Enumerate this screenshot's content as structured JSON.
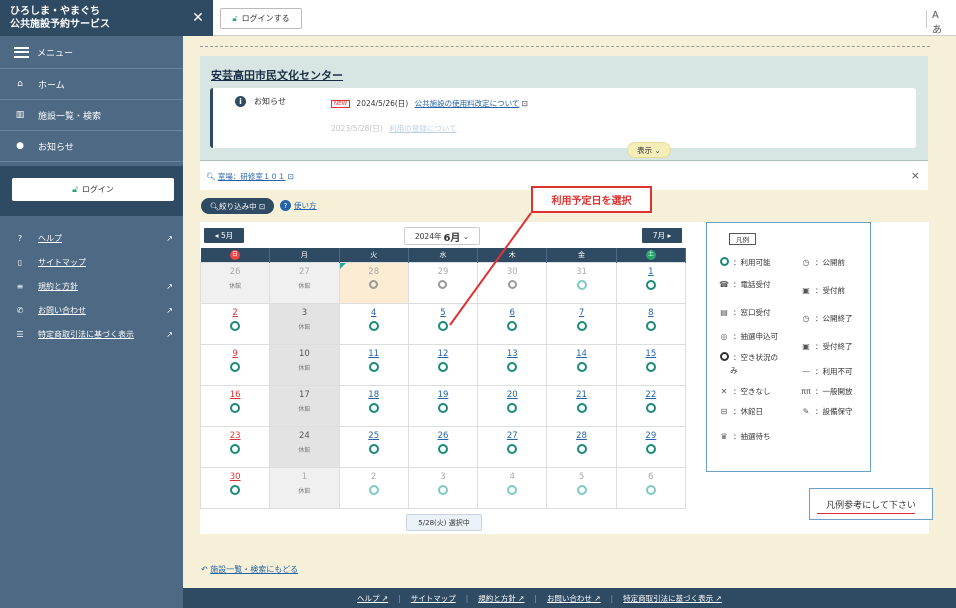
{
  "brand": {
    "line1": "ひろしま・やまぐち",
    "line2": "公共施設予約サービス"
  },
  "sidebar": {
    "menu_label": "メニュー",
    "items": [
      {
        "icon": "⌂",
        "label": "ホーム"
      },
      {
        "icon": "▥",
        "label": "施設一覧・検索"
      },
      {
        "icon": "●",
        "label": "お知らせ"
      }
    ],
    "login_label": "ログイン",
    "links": [
      {
        "icon": "?",
        "label": "ヘルプ",
        "ext": "↗"
      },
      {
        "icon": "▯",
        "label": "サイトマップ",
        "ext": ""
      },
      {
        "icon": "≡",
        "label": "規約と方針",
        "ext": "↗"
      },
      {
        "icon": "✆",
        "label": "お問い合わせ",
        "ext": "↗"
      },
      {
        "icon": "☰",
        "label": "特定商取引法に基づく表示",
        "ext": "↗"
      }
    ]
  },
  "topbar": {
    "close_icon": "✕",
    "login_label": "ログインする",
    "font_label": "Aあ"
  },
  "facility": {
    "name": "安芸高田市民文化センター"
  },
  "notice": {
    "label": "お知らせ",
    "row1": {
      "badge": "NEW",
      "date": "2024/5/26(日)",
      "text": "公共施設の使用料改定について"
    },
    "row2": {
      "date": "2023/5/28(日)",
      "text": "利用の登録について"
    },
    "show_label": "表示"
  },
  "filter": {
    "text": "室場：研修室１０１",
    "close": "×",
    "button": "絞り込み中",
    "howto": "使い方"
  },
  "calendar": {
    "prev": "5月",
    "next": "7月",
    "year_label": "2024年",
    "month_label": "6月",
    "weekdays": [
      "日",
      "月",
      "火",
      "水",
      "木",
      "金",
      "土"
    ],
    "closed_label": "休館",
    "selected_label": "5/28(火) 選択中",
    "rows": [
      [
        "26",
        "27",
        "28",
        "29",
        "30",
        "31",
        "1"
      ],
      [
        "2",
        "3",
        "4",
        "5",
        "6",
        "7",
        "8"
      ],
      [
        "9",
        "10",
        "11",
        "12",
        "13",
        "14",
        "15"
      ],
      [
        "16",
        "17",
        "18",
        "19",
        "20",
        "21",
        "22"
      ],
      [
        "23",
        "24",
        "25",
        "26",
        "27",
        "28",
        "29"
      ],
      [
        "30",
        "1",
        "2",
        "3",
        "4",
        "5",
        "6"
      ]
    ]
  },
  "legend": {
    "title": "凡例",
    "items": [
      {
        "icon": "o",
        "label": "：利用可能"
      },
      {
        "icon": "◷",
        "label": "：公開前"
      },
      {
        "icon": "☎",
        "label": "：電話受付"
      },
      {
        "icon": "▣",
        "label": "：受付前"
      },
      {
        "icon": "▤",
        "label": "：窓口受付"
      },
      {
        "icon": "◷",
        "label": "：公開終了"
      },
      {
        "icon": "◎",
        "label": "：抽選申込可"
      },
      {
        "icon": "▣",
        "label": "：受付終了"
      },
      {
        "icon": "ob",
        "label": "：空き状況の"
      },
      {
        "icon": "",
        "label": "み"
      },
      {
        "icon": "—",
        "label": "：利用不可"
      },
      {
        "icon": "✕",
        "label": "：空きなし"
      },
      {
        "icon": "ππ",
        "label": "：一般開放"
      },
      {
        "icon": "⊟",
        "label": "：休館日"
      },
      {
        "icon": "✎",
        "label": "：設備保守"
      },
      {
        "icon": "♛",
        "label": "：抽選待ち"
      }
    ]
  },
  "note": "凡例参考にして下さい",
  "annotation": "利用予定日を選択",
  "back_link": "施設一覧・検索にもどる",
  "footer": [
    "ヘルプ ↗",
    "サイトマップ",
    "規約と方針 ↗",
    "お問い合わせ ↗",
    "特定商取引法に基づく表示 ↗"
  ],
  "colors": {
    "sidebar": "#4d6984",
    "sidebar_dark": "#2f4a63",
    "main_bg": "#f7f0d8",
    "available": "#1b8a7a",
    "annotation": "#dd3333"
  }
}
